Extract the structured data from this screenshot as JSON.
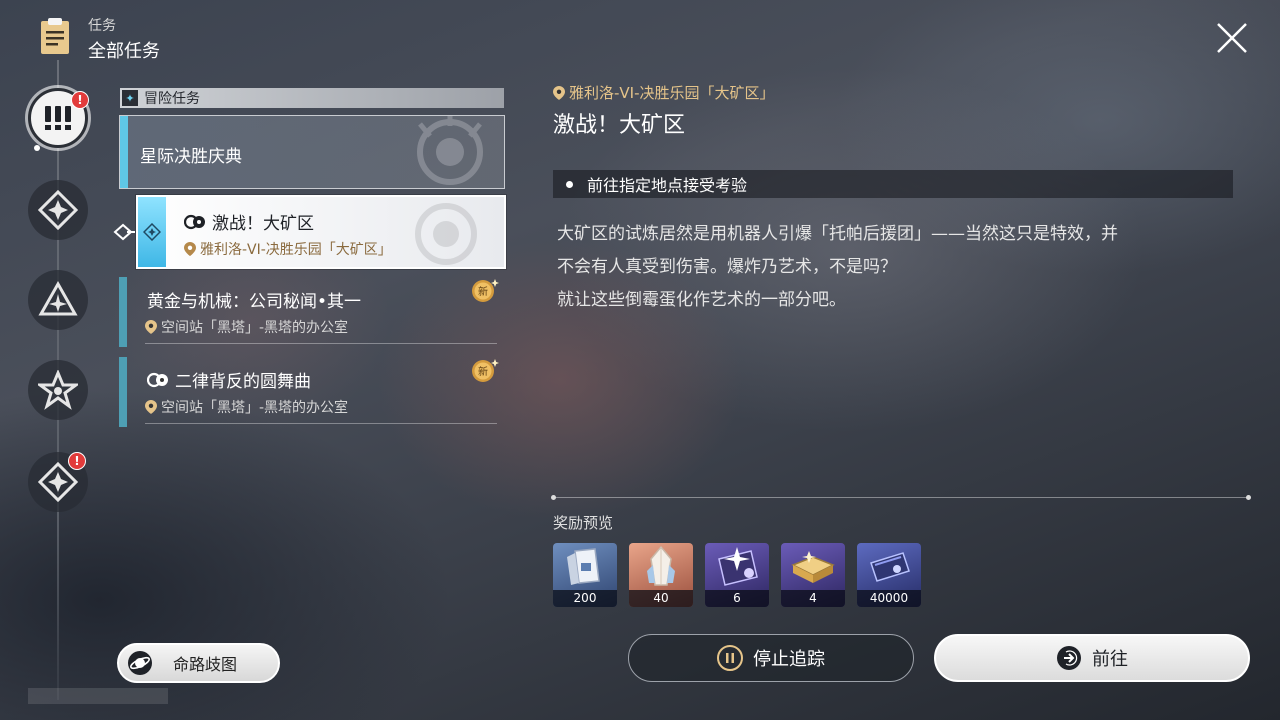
{
  "header": {
    "category_small": "任务",
    "category_big": "全部任务",
    "icons": [
      "clipboard-icon",
      "close-icon"
    ]
  },
  "rail": {
    "badge_text": "!",
    "items": [
      {
        "name": "adventure",
        "icon": "exclamation-icon",
        "active": true,
        "badge": true
      },
      {
        "name": "diamond",
        "icon": "diamond-star-icon",
        "active": false,
        "badge": false
      },
      {
        "name": "triangle",
        "icon": "triangle-icon",
        "active": false,
        "badge": false
      },
      {
        "name": "star",
        "icon": "star-icon",
        "active": false,
        "badge": false
      },
      {
        "name": "event",
        "icon": "diamond-star-icon",
        "active": false,
        "badge": true
      }
    ]
  },
  "mission_list": {
    "category": "冒险任务",
    "group": "星际决胜庆典",
    "selected": {
      "title": "激战！大矿区",
      "location": "雅利洛-VI-决胜乐园「大矿区」"
    },
    "missions": [
      {
        "title": "黄金与机械：公司秘闻•其一",
        "location": "空间站「黑塔」-黑塔的办公室",
        "is_new": true,
        "new_label": "新"
      },
      {
        "title": "二律背反的圆舞曲",
        "location": "空间站「黑塔」-黑塔的办公室",
        "is_new": true,
        "new_label": "新"
      }
    ]
  },
  "detail": {
    "location": "雅利洛-VI-决胜乐园「大矿区」",
    "title": "激战！大矿区",
    "objective": "前往指定地点接受考验",
    "description": [
      "大矿区的试炼居然是用机器人引爆「托帕后援团」——当然这只是特效，并",
      "不会有人真受到伤害。爆炸乃艺术，不是吗？",
      "就让这些倒霉蛋化作艺术的一部分吧。"
    ],
    "reward_label": "奖励预览",
    "rewards": [
      {
        "icon": "credit-chip-icon",
        "count": "200",
        "bg": "#3d5a86"
      },
      {
        "icon": "crystal-icon",
        "count": "40",
        "bg": "#b96e55"
      },
      {
        "icon": "star-book-icon",
        "count": "6",
        "bg": "#4b3f86"
      },
      {
        "icon": "gold-book-icon",
        "count": "4",
        "bg": "#4b3f86"
      },
      {
        "icon": "credit-card-icon",
        "count": "40000",
        "bg": "#3f4a86"
      }
    ]
  },
  "buttons": {
    "stop_tracking": "停止追踪",
    "go": "前往",
    "path": "命路歧图"
  },
  "colors": {
    "accent_cyan": "#5fc7e6",
    "location_gold": "#e5c48a",
    "badge_red": "#e23b3b"
  }
}
